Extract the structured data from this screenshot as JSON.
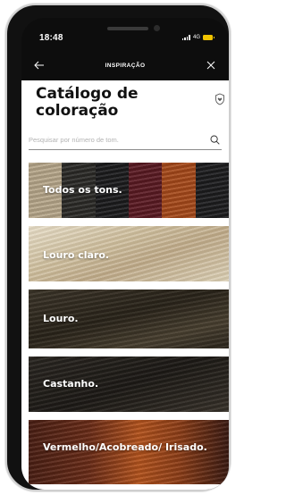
{
  "status_bar": {
    "time": "18:48",
    "network": "4G"
  },
  "nav": {
    "title": "INSPIRAÇÃO"
  },
  "catalog": {
    "title": "Catálogo de coloração"
  },
  "search": {
    "placeholder": "Pesquisar por número de tom."
  },
  "categories": [
    {
      "label": "Todos os tons.",
      "swatches": [
        "#b7a78b",
        "#2b2a27",
        "#1b1b1d",
        "#5a1a22",
        "#a6491a",
        "#1c1c1e"
      ]
    },
    {
      "label": "Louro claro."
    },
    {
      "label": "Louro."
    },
    {
      "label": "Castanho."
    },
    {
      "label": "Vermelho/Acobreado/ Irisado."
    }
  ],
  "colors": {
    "battery": "#f1c400",
    "sheet": "#ffffff",
    "header_bg": "#0d0d0d"
  }
}
